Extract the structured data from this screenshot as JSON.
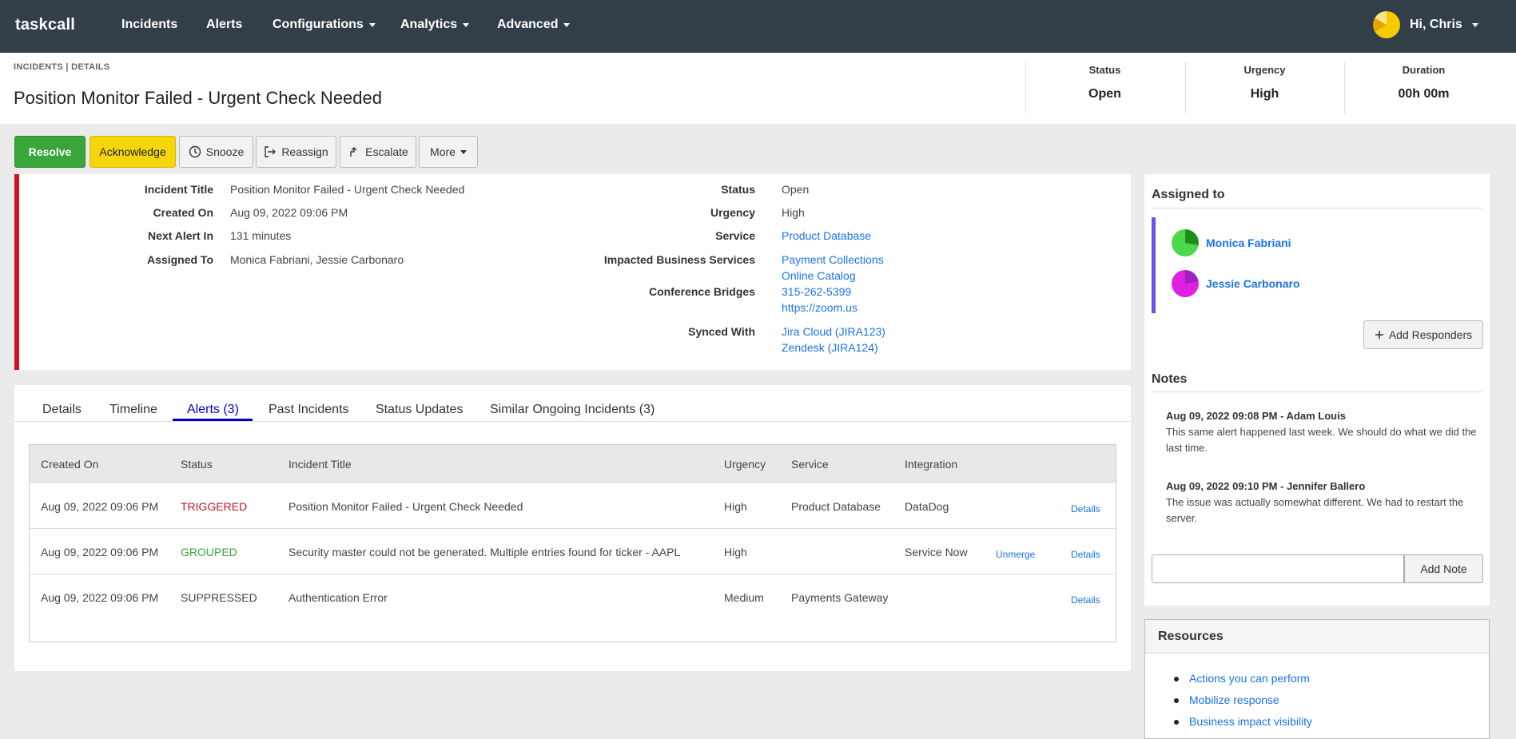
{
  "nav": {
    "brand": "taskcall",
    "items": [
      {
        "label": "Incidents",
        "dropdown": false
      },
      {
        "label": "Alerts",
        "dropdown": false
      },
      {
        "label": "Configurations",
        "dropdown": true
      },
      {
        "label": "Analytics",
        "dropdown": true
      },
      {
        "label": "Advanced",
        "dropdown": true
      }
    ],
    "user_greeting": "Hi, Chris"
  },
  "header": {
    "breadcrumb": "INCIDENTS | DETAILS",
    "title": "Position Monitor Failed - Urgent Check Needed",
    "stats": [
      {
        "label": "Status",
        "value": "Open"
      },
      {
        "label": "Urgency",
        "value": "High"
      },
      {
        "label": "Duration",
        "value": "00h 00m"
      }
    ]
  },
  "actions": {
    "resolve": "Resolve",
    "acknowledge": "Acknowledge",
    "snooze": "Snooze",
    "reassign": "Reassign",
    "escalate": "Escalate",
    "more": "More"
  },
  "details": {
    "left": [
      {
        "label": "Incident Title",
        "value": "Position Monitor Failed - Urgent Check Needed"
      },
      {
        "label": "Created On",
        "value": "Aug 09, 2022 09:06 PM"
      },
      {
        "label": "Next Alert In",
        "value": "131 minutes"
      },
      {
        "label": "Assigned To",
        "value": "Monica Fabriani, Jessie Carbonaro"
      }
    ],
    "right": {
      "status_label": "Status",
      "status": "Open",
      "urgency_label": "Urgency",
      "urgency": "High",
      "service_label": "Service",
      "service": "Product Database",
      "impacted_label": "Impacted Business Services",
      "impacted": [
        "Payment Collections",
        "Online Catalog"
      ],
      "bridges_label": "Conference Bridges",
      "bridges": [
        "315-262-5399",
        "https://zoom.us"
      ],
      "synced_label": "Synced With",
      "synced": [
        "Jira Cloud (JIRA123)",
        "Zendesk (JIRA124)"
      ]
    }
  },
  "tabs": [
    {
      "label": "Details",
      "active": false
    },
    {
      "label": "Timeline",
      "active": false
    },
    {
      "label": "Alerts (3)",
      "active": true
    },
    {
      "label": "Past Incidents",
      "active": false
    },
    {
      "label": "Status Updates",
      "active": false
    },
    {
      "label": "Similar Ongoing Incidents (3)",
      "active": false
    }
  ],
  "alerts_table": {
    "columns": [
      "Created On",
      "Status",
      "Incident Title",
      "Urgency",
      "Service",
      "Integration"
    ],
    "rows": [
      {
        "created": "Aug 09, 2022  09:06 PM",
        "status": "TRIGGERED",
        "title": "Position Monitor Failed - Urgent Check Needed",
        "urgency": "High",
        "service": "Product Database",
        "integration": "DataDog",
        "unmerge": "",
        "details": "Details"
      },
      {
        "created": "Aug 09, 2022  09:06 PM",
        "status": "GROUPED",
        "title": "Security master could not be generated. Multiple entries found for ticker - AAPL",
        "urgency": "High",
        "service": "",
        "integration": "Service Now",
        "unmerge": "Unmerge",
        "details": "Details"
      },
      {
        "created": "Aug 09, 2022  09:06 PM",
        "status": "SUPPRESSED",
        "title": "Authentication Error",
        "urgency": "Medium",
        "service": "Payments Gateway",
        "integration": "",
        "unmerge": "",
        "details": "Details"
      }
    ]
  },
  "assigned": {
    "title": "Assigned to",
    "people": [
      "Monica Fabriani",
      "Jessie Carbonaro"
    ],
    "add_responders": "Add Responders"
  },
  "notes": {
    "title": "Notes",
    "items": [
      {
        "head": "Aug 09, 2022 09:08 PM - Adam Louis",
        "body": "This same alert happened last week. We should do what we did the last time."
      },
      {
        "head": "Aug 09, 2022 09:10 PM - Jennifer Ballero",
        "body": "The issue was actually somewhat different. We had to restart the server."
      }
    ],
    "input_value": "",
    "add_note": "Add Note"
  },
  "resources": {
    "title": "Resources",
    "items": [
      "Actions you can perform",
      "Mobilize response",
      "Business impact visibility"
    ]
  },
  "colors": {
    "navbar": "#323e48",
    "resolve": "#3aa53a",
    "acknowledge": "#f4d60b",
    "incident_bar": "#d0121b",
    "assignee_bar": "#6b4fe8",
    "link": "#1a73e8",
    "triggered": "#c0151f",
    "grouped": "#3aa53a"
  },
  "icons": {
    "snooze": "clock-icon",
    "reassign": "reassign-arrow-icon",
    "escalate": "escalate-arrow-icon",
    "add": "plus-icon"
  }
}
